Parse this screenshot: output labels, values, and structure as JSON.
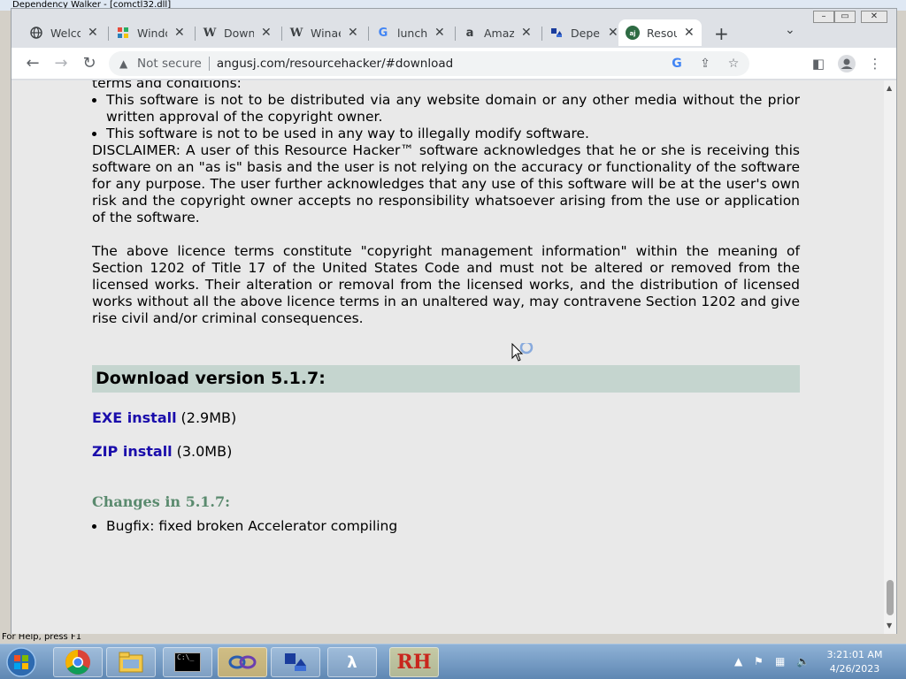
{
  "background_window": {
    "title": "Dependency Walker - [comctl32.dll]",
    "status_text": "For Help, press F1"
  },
  "tabs": [
    {
      "label": "Welcome",
      "icon": "globe-icon"
    },
    {
      "label": "Windows",
      "icon": "windows-icon"
    },
    {
      "label": "Download",
      "icon": "wikipedia-icon"
    },
    {
      "label": "Winaero",
      "icon": "wikipedia-icon"
    },
    {
      "label": "lunch",
      "icon": "google-icon"
    },
    {
      "label": "Amazon",
      "icon": "amazon-icon"
    },
    {
      "label": "Depends",
      "icon": "depends-icon"
    },
    {
      "label": "Resource",
      "icon": "angusj-icon",
      "active": true
    }
  ],
  "toolbar": {
    "security_label": "Not secure",
    "url": "angusj.com/resourcehacker/#download"
  },
  "content": {
    "intro_tail": "terms and conditions:",
    "terms": [
      "This software is not to be distributed via any website domain or any other media without the prior written approval of the copyright owner.",
      "This software is not to be used in any way to illegally modify software."
    ],
    "disclaimer": "DISCLAIMER: A user of this Resource Hacker™ software acknowledges that he or she is receiving this software on an \"as is\" basis and the user is not relying on the accuracy or functionality of the software for any purpose. The user further acknowledges that any use of this software will be at the user's own risk and the copyright owner accepts no responsibility whatsoever arising from the use or application of the software.",
    "licence": "The above licence terms constitute \"copyright management information\" within the meaning of Section 1202 of Title 17 of the United States Code and must not be altered or removed from the licensed works. Their alteration or removal from the licensed works, and the distribution of licensed works without all the above licence terms in an unaltered way, may contravene Section 1202 and give rise civil and/or criminal consequences.",
    "download_header": "Download version 5.1.7:",
    "exe_label": "EXE install",
    "exe_size": "(2.9MB)",
    "zip_label": "ZIP install",
    "zip_size": "(3.0MB)",
    "changes_header": "Changes in 5.1.7:",
    "changes": [
      "Bugfix: fixed broken Accelerator compiling"
    ]
  },
  "taskbar": {
    "apps": [
      "chrome-icon",
      "explorer-icon",
      "cmd-icon",
      "app-icon",
      "depends-icon",
      "lambda-icon",
      "resource-hacker-icon"
    ],
    "rh_label": "RH",
    "cmd_label": "C:\\_",
    "time": "3:21:01 AM",
    "date": "4/26/2023"
  }
}
